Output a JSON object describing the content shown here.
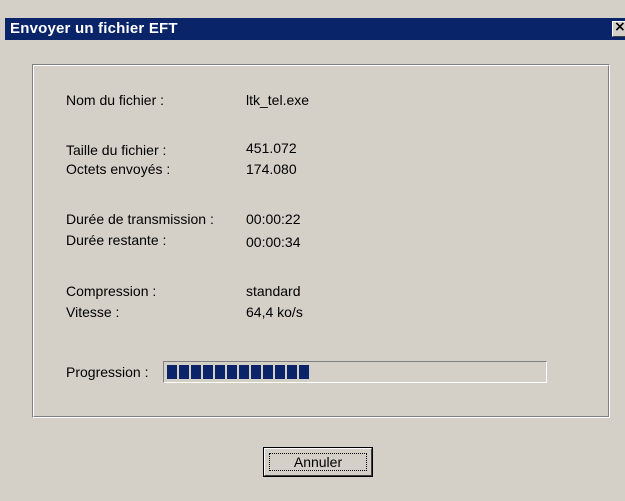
{
  "window": {
    "title": "Envoyer un fichier EFT",
    "close_glyph": "✕"
  },
  "details": {
    "file_name_label": "Nom du fichier :",
    "file_name_value": "ltk_tel.exe",
    "file_size_label": "Taille du fichier :",
    "file_size_value": "451.072",
    "bytes_sent_label": "Octets envoyés :",
    "bytes_sent_value": "174.080",
    "transmission_time_label": "Durée de transmission :",
    "transmission_time_value": "00:00:22",
    "remaining_time_label": "Durée restante :",
    "remaining_time_value": "00:00:34",
    "compression_label": "Compression :",
    "compression_value": "standard",
    "speed_label": "Vitesse :",
    "speed_value": "64,4 ko/s"
  },
  "progress": {
    "label": "Progression :",
    "fraction": 0.39,
    "color": "#0a246a"
  },
  "buttons": {
    "cancel_label": "Annuler"
  }
}
